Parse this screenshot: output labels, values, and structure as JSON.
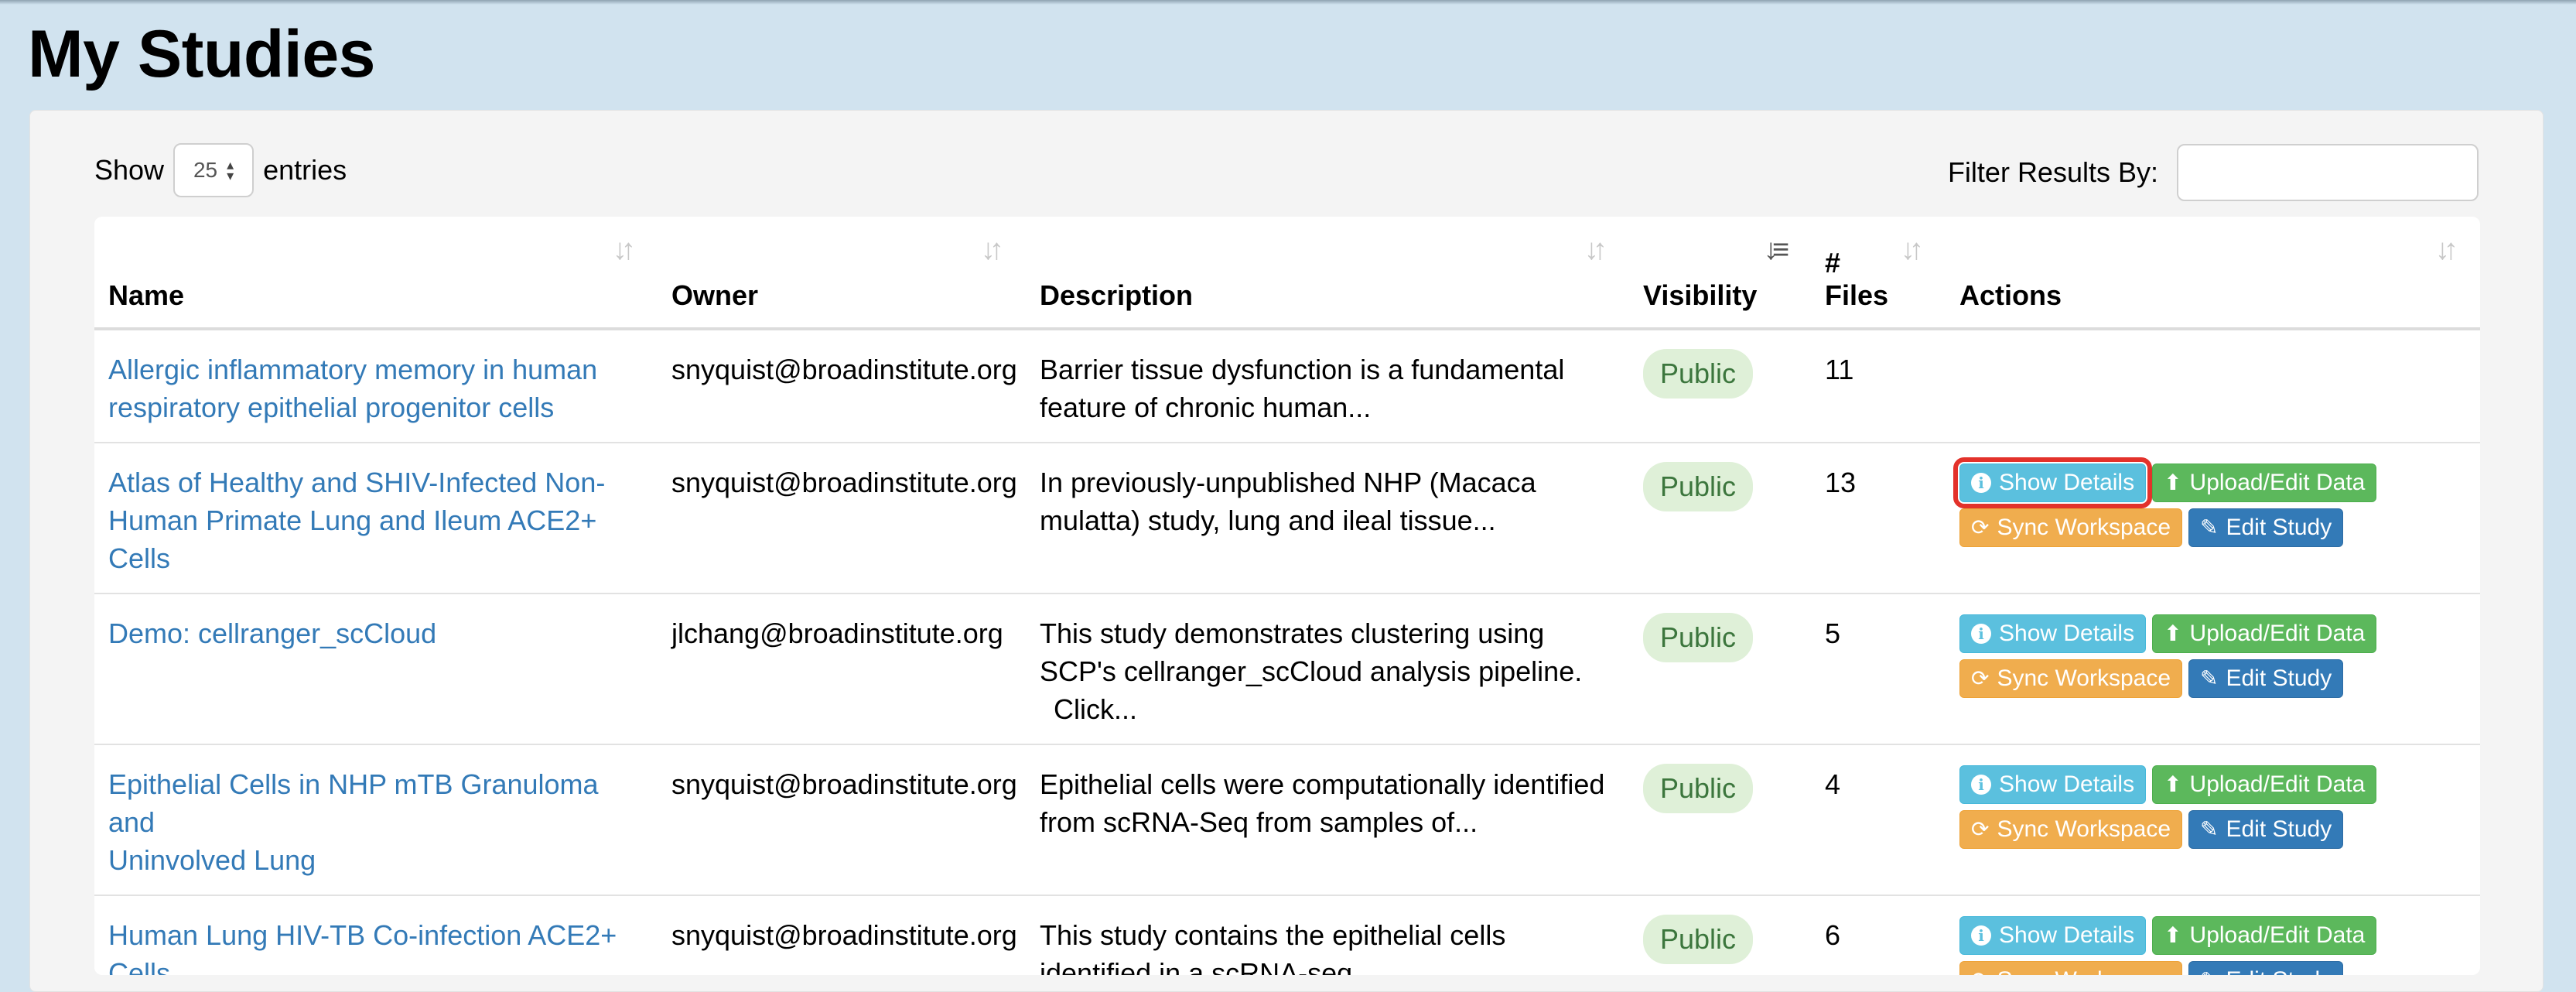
{
  "page": {
    "title": "My Studies"
  },
  "length": {
    "show_label": "Show",
    "value": "25",
    "entries_label": "entries"
  },
  "filter": {
    "label": "Filter Results By:",
    "value": ""
  },
  "columns": {
    "name": "Name",
    "owner": "Owner",
    "description": "Description",
    "visibility": "Visibility",
    "files_line1": "#",
    "files_line2": "Files",
    "actions": "Actions"
  },
  "buttons": {
    "show_details": "Show Details",
    "upload_edit": "Upload/Edit Data",
    "sync_workspace": "Sync Workspace",
    "edit_study": "Edit Study"
  },
  "icons": {
    "sort": "sort-icon",
    "sort_active": "sort-amount-desc-icon",
    "info": "info-circle-icon",
    "upload": "upload-icon",
    "sync": "refresh-icon",
    "edit": "edit-icon"
  },
  "colors": {
    "info": "#5bc0de",
    "success": "#5cb85c",
    "warning": "#f0ad4e",
    "primary": "#337ab7",
    "link": "#337ab7",
    "public_badge_bg": "#dff0d8",
    "public_badge_text": "#3c763d",
    "highlight": "#e3322b"
  },
  "rows": [
    {
      "name_l1": "Allergic inflammatory memory in human",
      "name_l2": "respiratory epithelial progenitor cells",
      "name_l3": "",
      "owner": "snyquist@broadinstitute.org",
      "desc_l1": "Barrier tissue dysfunction is a fundamental",
      "desc_l2": "feature of chronic human...",
      "desc_l3": "",
      "visibility": "Public",
      "files": "11"
    },
    {
      "name_l1": "Atlas of Healthy and SHIV-Infected Non-",
      "name_l2": "Human Primate Lung and Ileum ACE2+",
      "name_l3": "Cells",
      "owner": "snyquist@broadinstitute.org",
      "desc_l1": "In previously-unpublished NHP (Macaca",
      "desc_l2": "mulatta) study, lung and ileal tissue...",
      "desc_l3": "",
      "visibility": "Public",
      "files": "13"
    },
    {
      "name_l1": "Demo: cellranger_scCloud",
      "name_l2": "",
      "name_l3": "",
      "owner": "jlchang@broadinstitute.org",
      "desc_l1": "This study demonstrates clustering using",
      "desc_l2": "SCP's cellranger_scCloud analysis pipeline.",
      "desc_l3": "Click...",
      "visibility": "Public",
      "files": "5"
    },
    {
      "name_l1": "Epithelial Cells in NHP mTB Granuloma and",
      "name_l2": "Uninvolved Lung",
      "name_l3": "",
      "owner": "snyquist@broadinstitute.org",
      "desc_l1": "Epithelial cells were computationally identified",
      "desc_l2": "from scRNA-Seq from samples of...",
      "desc_l3": "",
      "visibility": "Public",
      "files": "4"
    },
    {
      "name_l1": "Human Lung HIV-TB Co-infection ACE2+",
      "name_l2": "Cells",
      "name_l3": "",
      "owner": "snyquist@broadinstitute.org",
      "desc_l1": "This study contains the epithelial cells",
      "desc_l2": "identified in a scRNA-seq...",
      "desc_l3": "",
      "visibility": "Public",
      "files": "6"
    }
  ]
}
